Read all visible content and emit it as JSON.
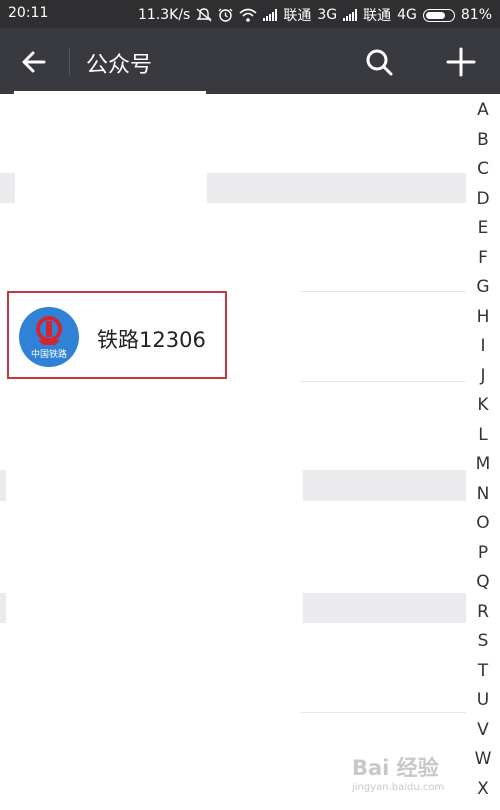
{
  "status_bar": {
    "time": "20:11",
    "speed": "11.3K/s",
    "carrier1": "联通",
    "net1": "3G",
    "carrier2": "联通",
    "net2": "4G",
    "battery_percent": "81%",
    "battery_level": 0.81
  },
  "header": {
    "title": "公众号",
    "icons": [
      "back-arrow-icon",
      "search-icon",
      "plus-icon"
    ]
  },
  "list": {
    "items": [
      {
        "label": "铁路12306",
        "avatar_text": "中国铁路"
      }
    ]
  },
  "index_letters": [
    "A",
    "B",
    "C",
    "D",
    "E",
    "F",
    "G",
    "H",
    "I",
    "J",
    "K",
    "L",
    "M",
    "N",
    "O",
    "P",
    "Q",
    "R",
    "S",
    "T",
    "U",
    "V",
    "W",
    "X"
  ],
  "watermark": "Bai 经验",
  "watermark_sub": "jingyan.baidu.com",
  "colors": {
    "status_bg": "#2f2f31",
    "header_bg": "#393a3f",
    "highlight_border": "#c5383f",
    "avatar_blue": "#2f82d6",
    "logo_red": "#d2252f"
  }
}
